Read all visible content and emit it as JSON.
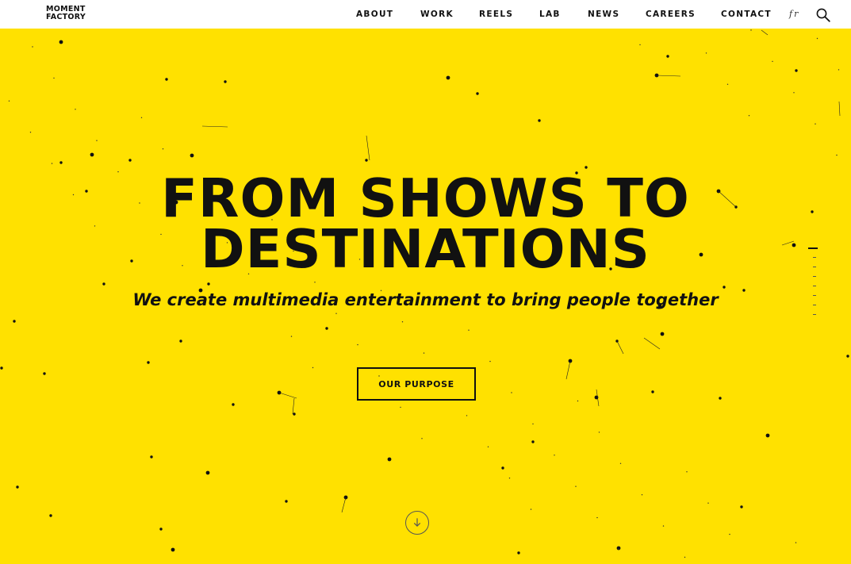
{
  "header": {
    "logo_line1": "MOMENT",
    "logo_line2": "FACTORY",
    "nav": [
      {
        "label": "ABOUT"
      },
      {
        "label": "WORK"
      },
      {
        "label": "REELS"
      },
      {
        "label": "LAB"
      },
      {
        "label": "NEWS"
      },
      {
        "label": "CAREERS"
      },
      {
        "label": "CONTACT"
      }
    ],
    "lang_toggle": "fr",
    "search_icon": "search-icon"
  },
  "hero": {
    "headline_line1": "FROM SHOWS TO",
    "headline_line2": "DESTINATIONS",
    "subtitle": "We create multimedia entertainment to bring people together",
    "cta_label": "OUR PURPOSE",
    "scroll_icon": "arrow-down-circle-icon",
    "section_indicator_count": 8,
    "active_section": 1
  },
  "colors": {
    "background": "#ffe100",
    "header": "#ffffff",
    "text": "#111111"
  }
}
